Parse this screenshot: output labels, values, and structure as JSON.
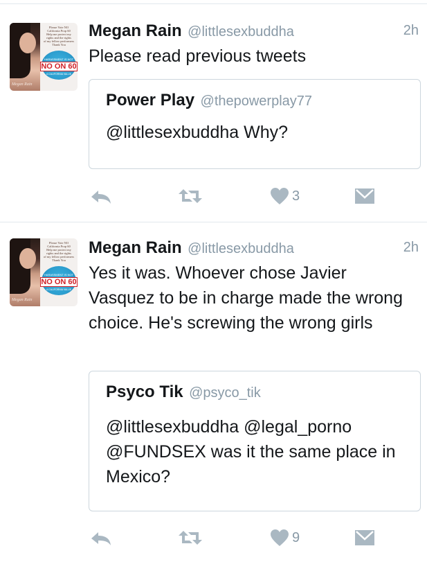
{
  "colors": {
    "text": "#14171a",
    "secondary": "#8899a6",
    "border": "#ccd6dd",
    "divider": "#e1e8ed",
    "icon": "#aab8c2"
  },
  "avatar": {
    "lines": [
      "Please Vote NO",
      "California Prop 60",
      "Help me protect my",
      "rights and the rights",
      "of my fellow performers",
      "Thank You"
    ],
    "harassment": "HARASSMENT IS NOT",
    "slogan": "NO ON 60",
    "value": "A CALIFORNIA VALUE",
    "signature": "Megan Rain"
  },
  "tweets": [
    {
      "name": "Megan Rain",
      "handle": "@littlesexbuddha",
      "time": "2h",
      "text": "Please read previous tweets",
      "quote": {
        "name": "Power Play",
        "handle": "@thepowerplay77",
        "text": "@littlesexbuddha Why?"
      },
      "likes": "3",
      "icons": [
        "reply-icon",
        "retweet-icon",
        "heart-icon",
        "envelope-icon"
      ]
    },
    {
      "name": "Megan Rain",
      "handle": "@littlesexbuddha",
      "time": "2h",
      "text": "Yes it was. Whoever chose Javier Vasquez to be in charge made the wrong choice. He's screwing the wrong girls",
      "quote": {
        "name": "Psyco Tik",
        "handle": "@psyco_tik",
        "text": "@littlesexbuddha @legal_porno @FUNDSEX was it the same place in Mexico?"
      },
      "likes": "9",
      "icons": [
        "reply-icon",
        "retweet-icon",
        "heart-icon",
        "envelope-icon"
      ]
    }
  ]
}
